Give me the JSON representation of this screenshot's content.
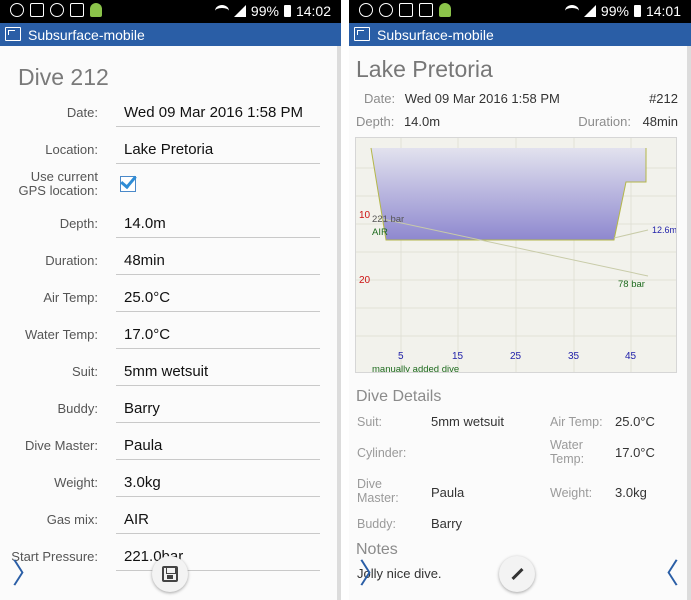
{
  "status_bar": {
    "left": {
      "battery": "99%",
      "time": "14:02"
    },
    "right": {
      "battery": "99%",
      "time": "14:01"
    }
  },
  "app": {
    "title": "Subsurface-mobile"
  },
  "edit": {
    "title": "Dive 212",
    "gps_label": "Use current GPS location:",
    "gps_checked": true,
    "fields": [
      {
        "label": "Date:",
        "value": "Wed 09 Mar 2016 1:58 PM"
      },
      {
        "label": "Location:",
        "value": "Lake Pretoria"
      },
      {
        "label": "Depth:",
        "value": "14.0m"
      },
      {
        "label": "Duration:",
        "value": "48min"
      },
      {
        "label": "Air Temp:",
        "value": "25.0°C"
      },
      {
        "label": "Water Temp:",
        "value": "17.0°C"
      },
      {
        "label": "Suit:",
        "value": "5mm wetsuit"
      },
      {
        "label": "Buddy:",
        "value": "Barry"
      },
      {
        "label": "Dive Master:",
        "value": "Paula"
      },
      {
        "label": "Weight:",
        "value": "3.0kg"
      },
      {
        "label": "Gas mix:",
        "value": "AIR"
      },
      {
        "label": "Start Pressure:",
        "value": "221.0bar"
      }
    ]
  },
  "detail": {
    "location": "Lake Pretoria",
    "date_label": "Date:",
    "date_value": "Wed 09 Mar 2016 1:58 PM",
    "number": "#212",
    "depth_label": "Depth:",
    "depth_value": "14.0m",
    "duration_label": "Duration:",
    "duration_value": "48min",
    "profile": {
      "depth_tick_10": "10",
      "depth_tick_20": "20",
      "time_ticks": [
        "5",
        "15",
        "25",
        "35",
        "45"
      ],
      "start_pressure": "221 bar",
      "gas": "AIR",
      "end_pressure": "78 bar",
      "max_depth": "12.6m",
      "note": "manually added dive",
      "colors": {
        "fill_top": "#e2e2ee",
        "fill_bottom": "#8e88cf",
        "depth_text": "#cc1111",
        "time_text": "#2222aa",
        "gas_text": "#1e6b1e"
      }
    },
    "details_title": "Dive Details",
    "suit_label": "Suit:",
    "suit_value": "5mm wetsuit",
    "airtemp_label": "Air Temp:",
    "airtemp_value": "25.0°C",
    "cylinder_label": "Cylinder:",
    "watertemp_label": "Water Temp:",
    "watertemp_value": "17.0°C",
    "divemaster_label": "Dive Master:",
    "divemaster_value": "Paula",
    "weight_label": "Weight:",
    "weight_value": "3.0kg",
    "buddy_label": "Buddy:",
    "buddy_value": "Barry",
    "notes_title": "Notes",
    "notes_value": "Jolly nice dive."
  },
  "icons": {
    "save": "save-icon",
    "edit": "pencil-icon",
    "next": "chevron-right-icon",
    "prev": "chevron-left-icon"
  }
}
